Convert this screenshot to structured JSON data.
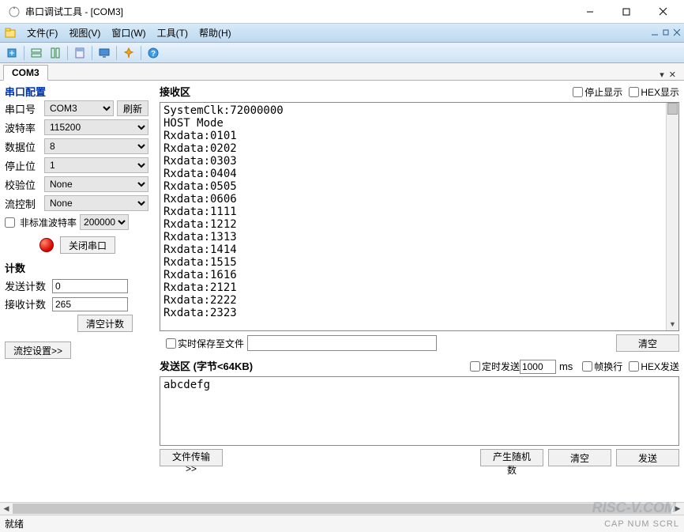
{
  "window": {
    "title": "串口调试工具 - [COM3]"
  },
  "menu": {
    "file": "文件(F)",
    "view": "视图(V)",
    "window": "窗口(W)",
    "tools": "工具(T)",
    "help": "帮助(H)"
  },
  "tabs": {
    "active": "COM3"
  },
  "config": {
    "title": "串口配置",
    "port_label": "串口号",
    "port_value": "COM3",
    "refresh": "刷新",
    "baud_label": "波特率",
    "baud_value": "115200",
    "databits_label": "数据位",
    "databits_value": "8",
    "stopbits_label": "停止位",
    "stopbits_value": "1",
    "parity_label": "校验位",
    "parity_value": "None",
    "flow_label": "流控制",
    "flow_value": "None",
    "nonstd_label": "非标准波特率",
    "nonstd_value": "200000",
    "close_port": "关闭串口"
  },
  "counts": {
    "title": "计数",
    "send_label": "发送计数",
    "send_value": "0",
    "recv_label": "接收计数",
    "recv_value": "265",
    "clear": "清空计数"
  },
  "flow_settings": "流控设置>>",
  "rx": {
    "title": "接收区",
    "pause": "停止显示",
    "hex": "HEX显示",
    "lines": [
      "SystemClk:72000000",
      "HOST Mode",
      "Rxdata:0101",
      "Rxdata:0202",
      "Rxdata:0303",
      "Rxdata:0404",
      "Rxdata:0505",
      "Rxdata:0606",
      "Rxdata:1111",
      "Rxdata:1212",
      "Rxdata:1313",
      "Rxdata:1414",
      "Rxdata:1515",
      "Rxdata:1616",
      "Rxdata:2121",
      "Rxdata:2222",
      "Rxdata:2323"
    ],
    "save_label": "实时保存至文件",
    "clear": "清空"
  },
  "tx": {
    "title": "发送区 (字节<64KB)",
    "timed_label": "定时发送",
    "timed_value": "1000",
    "timed_unit": "ms",
    "wrap_label": "帧换行",
    "hex_label": "HEX发送",
    "content": "abcdefg",
    "file_transfer": "文件传输>>",
    "rand": "产生随机数",
    "clear": "清空",
    "send": "发送"
  },
  "status": {
    "ready": "就绪",
    "caps": "CAP NUM SCRL"
  },
  "watermark": "RISC-V.COM"
}
